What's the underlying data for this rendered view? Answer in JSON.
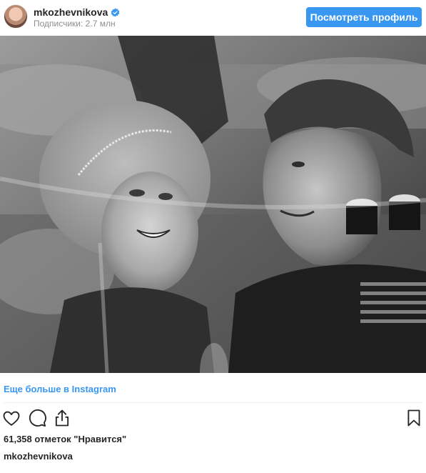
{
  "header": {
    "username": "mkozhevnikova",
    "followers": "Подписчики: 2.7 млн",
    "view_profile_label": "Посмотреть профиль"
  },
  "post": {
    "photo_icon": "black-and-white-couple-photo",
    "more_link": "Еще больше в Instagram",
    "likes": "61,358 отметок \"Нравится\"",
    "caption_username": "mkozhevnikova"
  },
  "icons": {
    "verified": "verified-badge-icon",
    "like": "heart-icon",
    "comment": "comment-bubble-icon",
    "share": "share-icon",
    "save": "bookmark-icon"
  },
  "colors": {
    "accent": "#3897f0",
    "text": "#262626",
    "muted": "#8e8e8e"
  }
}
